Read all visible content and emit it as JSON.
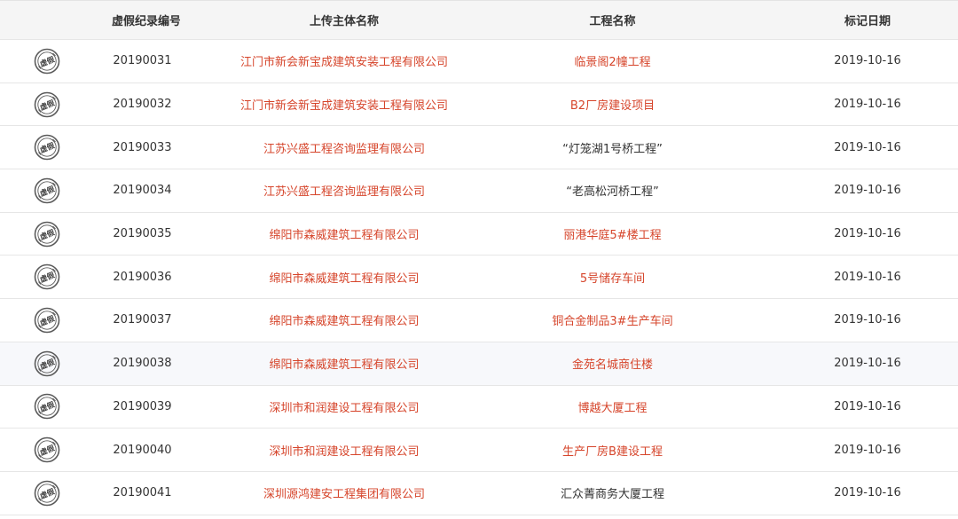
{
  "headers": {
    "id": "虚假纪录编号",
    "company": "上传主体名称",
    "project": "工程名称",
    "date": "标记日期"
  },
  "stamp_icon": "fake-stamp-icon",
  "stamp_text": "虚假",
  "colors": {
    "link": "#d6452b",
    "text": "#333333",
    "header_bg": "#f5f5f5"
  },
  "rows": [
    {
      "id": "20190031",
      "company": "江门市新会新宝成建筑安装工程有限公司",
      "project": "临景阁2幢工程",
      "date": "2019-10-16"
    },
    {
      "id": "20190032",
      "company": "江门市新会新宝成建筑安装工程有限公司",
      "project": "B2厂房建设项目",
      "date": "2019-10-16"
    },
    {
      "id": "20190033",
      "company": "江苏兴盛工程咨询监理有限公司",
      "project": "“灯笼湖1号桥工程”",
      "date": "2019-10-16"
    },
    {
      "id": "20190034",
      "company": "江苏兴盛工程咨询监理有限公司",
      "project": "“老高松河桥工程”",
      "date": "2019-10-16"
    },
    {
      "id": "20190035",
      "company": "绵阳市森威建筑工程有限公司",
      "project": "丽港华庭5#楼工程",
      "date": "2019-10-16"
    },
    {
      "id": "20190036",
      "company": "绵阳市森威建筑工程有限公司",
      "project": "5号储存车间",
      "date": "2019-10-16"
    },
    {
      "id": "20190037",
      "company": "绵阳市森威建筑工程有限公司",
      "project": "铜合金制品3#生产车间",
      "date": "2019-10-16"
    },
    {
      "id": "20190038",
      "company": "绵阳市森威建筑工程有限公司",
      "project": "金苑名城商住楼",
      "date": "2019-10-16"
    },
    {
      "id": "20190039",
      "company": "深圳市和润建设工程有限公司",
      "project": "博越大厦工程",
      "date": "2019-10-16"
    },
    {
      "id": "20190040",
      "company": "深圳市和润建设工程有限公司",
      "project": "生产厂房B建设工程",
      "date": "2019-10-16"
    },
    {
      "id": "20190041",
      "company": "深圳源鸿建安工程集团有限公司",
      "project": "汇众菁商务大厦工程",
      "date": "2019-10-16"
    }
  ]
}
